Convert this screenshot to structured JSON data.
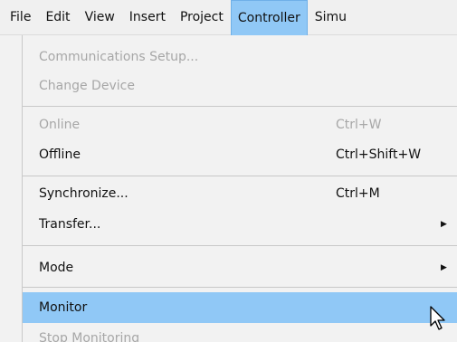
{
  "menubar": {
    "items": [
      "File",
      "Edit",
      "View",
      "Insert",
      "Project",
      "Controller",
      "Simu"
    ],
    "active_index": 5
  },
  "dropdown": {
    "communications_setup": {
      "label": "Communications Setup..."
    },
    "change_device": {
      "label": "Change Device"
    },
    "online": {
      "label": "Online",
      "shortcut": "Ctrl+W"
    },
    "offline": {
      "label": "Offline",
      "shortcut": "Ctrl+Shift+W"
    },
    "synchronize": {
      "label": "Synchronize...",
      "shortcut": "Ctrl+M"
    },
    "transfer": {
      "label": "Transfer..."
    },
    "mode": {
      "label": "Mode"
    },
    "monitor": {
      "label": "Monitor"
    },
    "stop_monitoring": {
      "label": "Stop Monitoring"
    }
  },
  "colors": {
    "highlight": "#90c8f6",
    "disabled_text": "#a7a7a7",
    "menu_bg": "#f2f2f2"
  },
  "icons": {
    "submenu_arrow": "triangle-right",
    "cursor": "mouse-pointer"
  }
}
